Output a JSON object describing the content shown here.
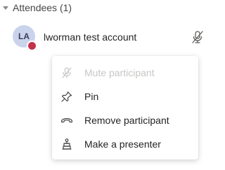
{
  "attendees_section": {
    "label": "Attendees (1)"
  },
  "attendee": {
    "initials": "LA",
    "name": "lworman test account",
    "presence_color": "#c4314b",
    "mic_icon": "mic-off-icon"
  },
  "context_menu": {
    "items": [
      {
        "label": "Mute participant",
        "icon": "mic-off-icon",
        "disabled": true
      },
      {
        "label": "Pin",
        "icon": "pin-icon",
        "disabled": false
      },
      {
        "label": "Remove participant",
        "icon": "hang-up-icon",
        "disabled": false
      },
      {
        "label": "Make a presenter",
        "icon": "presenter-icon",
        "disabled": false
      }
    ]
  }
}
